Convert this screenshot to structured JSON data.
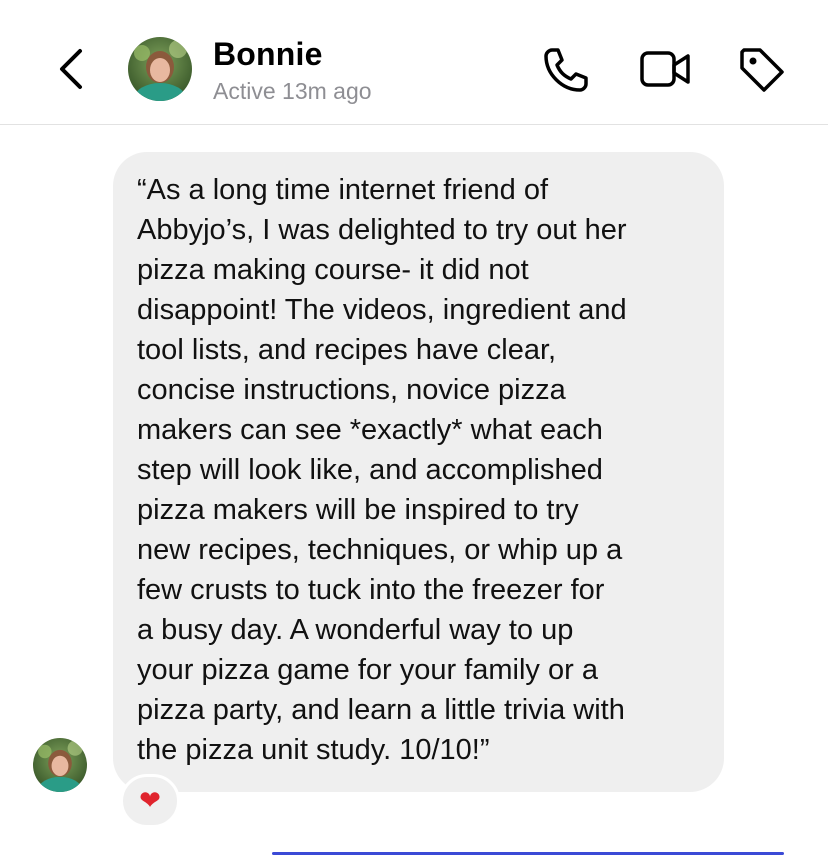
{
  "header": {
    "contact_name": "Bonnie",
    "status": "Active 13m ago",
    "icons": {
      "back": "chevron-left-icon",
      "call": "phone-icon",
      "video": "video-camera-icon",
      "tag": "tag-icon"
    }
  },
  "message": {
    "text": "“As a long time internet friend of\nAbbyjo’s, I was delighted to try out her\npizza making course- it did not\ndisappoint! The videos, ingredient and\ntool lists, and recipes have clear,\nconcise instructions, novice pizza\nmakers can see *exactly* what each\nstep will look like, and accomplished\npizza makers will be inspired to try\nnew recipes, techniques, or whip up a\nfew crusts to tuck into the freezer for\na busy day. A wonderful way to up\nyour pizza game for your family or a\npizza party, and learn a little trivia with\nthe pizza unit study. 10/10!”",
    "reaction": "❤"
  },
  "colors": {
    "bubble": "#efefef",
    "status_text": "#8e8e93",
    "reaction_heart": "#e0242d",
    "divider": "#e2e2e2"
  }
}
